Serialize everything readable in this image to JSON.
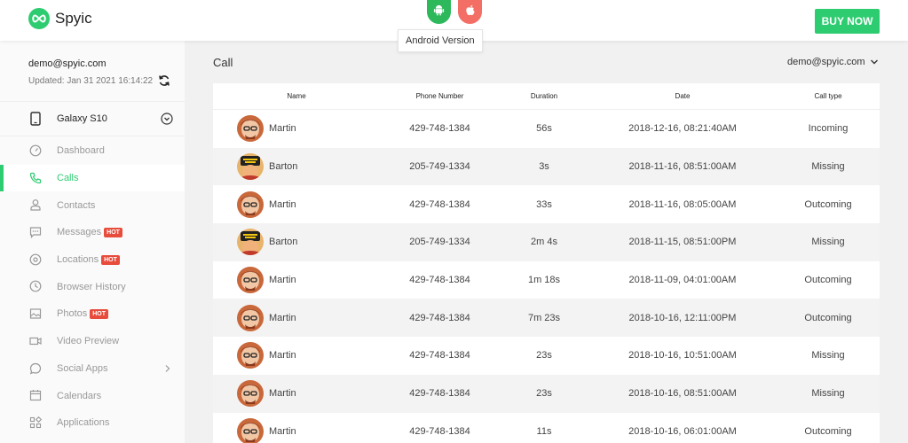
{
  "brand": {
    "name": "Spyic",
    "color": "#2ecc71"
  },
  "header": {
    "android_icon": "android-icon",
    "apple_icon": "apple-icon",
    "tooltip": "Android Version",
    "buy_label": "BUY NOW"
  },
  "account": {
    "email": "demo@spyic.com",
    "updated": "Updated: Jan 31 2021 16:14:22"
  },
  "device": {
    "name": "Galaxy S10"
  },
  "nav": [
    {
      "label": "Dashboard",
      "icon": "gauge-icon",
      "hot": false,
      "active": false
    },
    {
      "label": "Calls",
      "icon": "phone-icon",
      "hot": false,
      "active": true
    },
    {
      "label": "Contacts",
      "icon": "user-icon",
      "hot": false,
      "active": false
    },
    {
      "label": "Messages",
      "icon": "message-icon",
      "hot": true,
      "active": false
    },
    {
      "label": "Locations",
      "icon": "location-icon",
      "hot": true,
      "active": false
    },
    {
      "label": "Browser History",
      "icon": "clock-icon",
      "hot": false,
      "active": false
    },
    {
      "label": "Photos",
      "icon": "image-icon",
      "hot": true,
      "active": false
    },
    {
      "label": "Video Preview",
      "icon": "video-icon",
      "hot": false,
      "active": false
    },
    {
      "label": "Social Apps",
      "icon": "chat-bubble-icon",
      "hot": false,
      "active": false
    },
    {
      "label": "Calendars",
      "icon": "calendar-icon",
      "hot": false,
      "active": false
    },
    {
      "label": "Applications",
      "icon": "apps-grid-icon",
      "hot": false,
      "active": false
    }
  ],
  "hot_label": "HOT",
  "main": {
    "title": "Call",
    "user_menu": "demo@spyic.com"
  },
  "table": {
    "columns": [
      "Name",
      "Phone Number",
      "Duration",
      "Date",
      "Call type"
    ],
    "rows": [
      {
        "name": "Martin",
        "phone": "429-748-1384",
        "duration": "56s",
        "date": "2018-12-16, 08:21:40AM",
        "type": "Incoming"
      },
      {
        "name": "Barton",
        "phone": "205-749-1334",
        "duration": "3s",
        "date": "2018-11-16, 08:51:00AM",
        "type": "Missing"
      },
      {
        "name": "Martin",
        "phone": "429-748-1384",
        "duration": "33s",
        "date": "2018-11-16, 08:05:00AM",
        "type": "Outcoming"
      },
      {
        "name": "Barton",
        "phone": "205-749-1334",
        "duration": "2m 4s",
        "date": "2018-11-15, 08:51:00PM",
        "type": "Missing"
      },
      {
        "name": "Martin",
        "phone": "429-748-1384",
        "duration": "1m 18s",
        "date": "2018-11-09, 04:01:00AM",
        "type": "Outcoming"
      },
      {
        "name": "Martin",
        "phone": "429-748-1384",
        "duration": "7m 23s",
        "date": "2018-10-16, 12:11:00PM",
        "type": "Outcoming"
      },
      {
        "name": "Martin",
        "phone": "429-748-1384",
        "duration": "23s",
        "date": "2018-10-16, 10:51:00AM",
        "type": "Missing"
      },
      {
        "name": "Martin",
        "phone": "429-748-1384",
        "duration": "23s",
        "date": "2018-10-16, 08:51:00AM",
        "type": "Missing"
      },
      {
        "name": "Martin",
        "phone": "429-748-1384",
        "duration": "11s",
        "date": "2018-10-16, 06:01:00AM",
        "type": "Outcoming"
      }
    ]
  }
}
